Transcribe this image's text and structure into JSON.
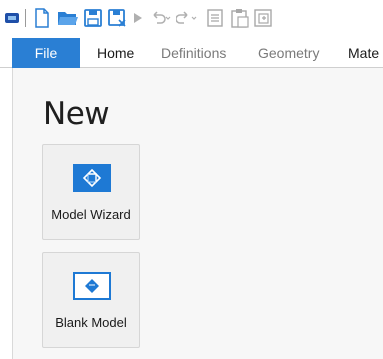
{
  "quick_access": {
    "icons": [
      "app-icon",
      "new-file-icon",
      "open-folder-icon",
      "save-icon",
      "save-as-icon",
      "run-icon",
      "undo-icon",
      "redo-icon",
      "copy-icon",
      "paste-icon",
      "duplicate-icon"
    ]
  },
  "tabs": [
    {
      "label": "File",
      "state": "selected"
    },
    {
      "label": "Home",
      "state": "active"
    },
    {
      "label": "Definitions",
      "state": "inactive"
    },
    {
      "label": "Geometry",
      "state": "inactive"
    },
    {
      "label": "Mate",
      "state": "active"
    }
  ],
  "backstage": {
    "heading": "New",
    "model_wizard_label": "Model Wizard",
    "blank_model_label": "Blank Model"
  },
  "colors": {
    "accent": "#2a7fd4",
    "tile_background": "#f0f0f0",
    "icon_blue": "#1e79d4"
  }
}
